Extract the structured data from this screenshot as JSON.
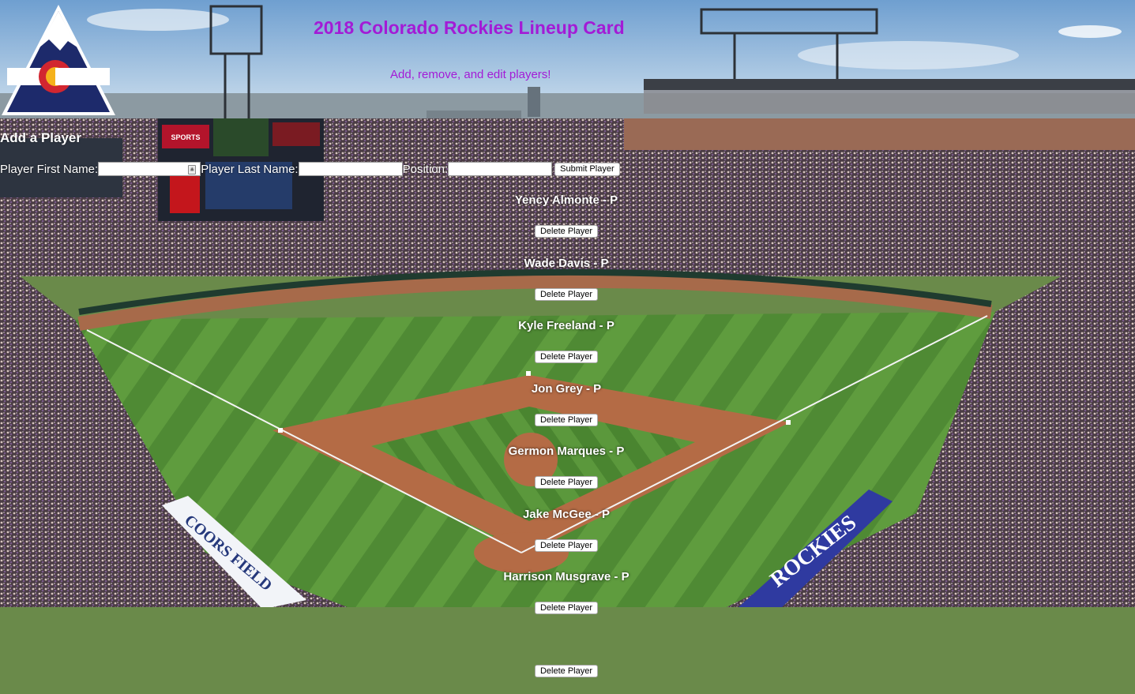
{
  "page": {
    "title": "2018 Colorado Rockies Lineup Card",
    "subtitle": "Add, remove, and edit players!"
  },
  "form": {
    "heading": "Add a Player",
    "first_name_label": "Player First Name:",
    "first_name_value": "",
    "last_name_label": "Player Last Name:",
    "last_name_value": "",
    "position_label": "Position:",
    "position_value": "",
    "submit_label": "Submit Player"
  },
  "players": [
    {
      "name": "Yency Almonte - P",
      "delete_label": "Delete Player"
    },
    {
      "name": "Wade Davis - P",
      "delete_label": "Delete Player"
    },
    {
      "name": "Kyle Freeland - P",
      "delete_label": "Delete Player"
    },
    {
      "name": "Jon Grey - P",
      "delete_label": "Delete Player"
    },
    {
      "name": "Germon Marques - P",
      "delete_label": "Delete Player"
    },
    {
      "name": "Jake McGee - P",
      "delete_label": "Delete Player"
    },
    {
      "name": "Harrison Musgrave - P",
      "delete_label": "Delete Player"
    },
    {
      "name": "",
      "delete_label": "Delete Player"
    }
  ],
  "colors": {
    "title": "#a31bd6",
    "logo_navy": "#1d2a6b",
    "logo_red": "#d22630",
    "logo_gold": "#f5b21b"
  },
  "background": {
    "banner_left": "COORS FIELD",
    "banner_right": "ROCKIES",
    "scoreboard_ad": "SPORTS AUTHORITY"
  }
}
